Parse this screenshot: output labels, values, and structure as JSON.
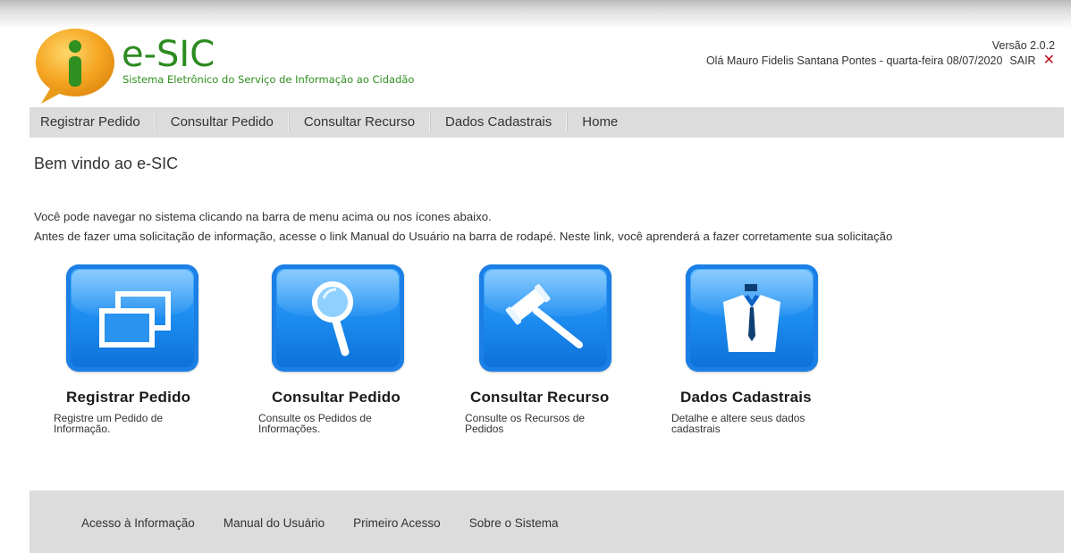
{
  "header": {
    "brand_title": "e-SIC",
    "brand_subtitle": "Sistema Eletrônico do Serviço de Informação ao Cidadão",
    "version": "Versão 2.0.2",
    "greeting": "Olá Mauro Fidelis Santana Pontes - quarta-feira 08/07/2020",
    "logout_label": "SAIR"
  },
  "menu": [
    {
      "label": "Registrar Pedido"
    },
    {
      "label": "Consultar Pedido"
    },
    {
      "label": "Consultar Recurso"
    },
    {
      "label": "Dados Cadastrais"
    },
    {
      "label": "Home"
    }
  ],
  "main": {
    "welcome": "Bem vindo ao e-SIC",
    "intro_line1": "Você pode navegar no sistema clicando na barra de menu acima ou nos ícones abaixo.",
    "intro_line2": "Antes de fazer uma solicitação de informação, acesse o link Manual do Usuário na barra de rodapé. Neste link, você aprenderá a fazer corretamente sua solicitação",
    "cards": [
      {
        "title": "Registrar Pedido",
        "desc": "Registre um Pedido de Informação.",
        "icon": "windows-icon"
      },
      {
        "title": "Consultar Pedido",
        "desc": "Consulte os Pedidos de Informações.",
        "icon": "magnifier-icon"
      },
      {
        "title": "Consultar Recurso",
        "desc": "Consulte os Recursos de Pedidos",
        "icon": "gavel-icon"
      },
      {
        "title": "Dados Cadastrais",
        "desc": "Detalhe e altere seus dados cadastrais",
        "icon": "person-suit-icon"
      }
    ]
  },
  "footer": {
    "links": [
      {
        "label": "Acesso à Informação"
      },
      {
        "label": "Manual do Usuário"
      },
      {
        "label": "Primeiro Acesso"
      },
      {
        "label": "Sobre o Sistema"
      }
    ]
  },
  "colors": {
    "brand_green": "#2b8b1f",
    "logo_orange": "#f5a623",
    "tile_blue": "#1f8ff2",
    "logout_red": "#c0121a",
    "bar_gray": "#dcdcdc"
  }
}
